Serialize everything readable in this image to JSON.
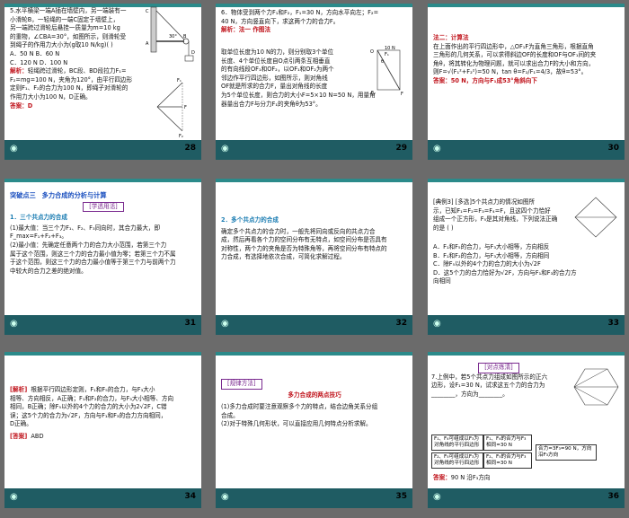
{
  "slides": [
    {
      "num": "28",
      "lines": [
        "5.水平横梁一端A插在墙壁内，另一端装有一",
        "小滑轮B，一轻绳的一端C固定于墙壁上，",
        "另一端跨过滑轮后悬挂一质量为m=10 kg",
        "的重物，∠CBA=30°，如图所示，则滑轮受",
        "到绳子的作用力大小为(g取10 N/kg)(    )",
        "A．50 N                 B．60 N",
        "C．120 N               D．100 N"
      ],
      "analysis_label": "解析：",
      "analysis_lines": [
        "轻绳跨过滑轮，BC段、BD段拉力F₁=",
        "F₂=mg=100 N，夹角为120°，由平行四边形",
        "定则F₁、F₂的合力为100 N，即绳子对滑轮的",
        "作用力大小为100 N，D正确。"
      ],
      "answer": "答案：D",
      "fig_labels": [
        "C",
        "A",
        "B",
        "30°",
        "D",
        "F₁",
        "F",
        "F₂"
      ]
    },
    {
      "num": "29",
      "lines": [
        "6．物体受到两个力F₁和F₂，F₁=30 N，方向水平向左；F₂=",
        "40 N，方向竖直向下，求这两个力的合力F。"
      ],
      "analysis_label": "解析：",
      "method": "法一  作图法",
      "analysis_lines": [
        "取单位长度为10 N的力，则分别取3个单位",
        "长度、4个单位长度自O点引两条互相垂直",
        "的有向线段OF₁和OF₂，以OF₁和OF₂为两个",
        "邻边作平行四边形，如图所示，则对角线",
        "OF就是所求的合力F，量出对角线的长度",
        "为5个单位长度，则合力的大小F=5×10 N=50 N，用量角",
        "器量出合力F与分力F₁的夹角θ为53°。"
      ],
      "fig_labels": [
        "10 N",
        "F₁",
        "O",
        "θ",
        "F₂",
        "F"
      ]
    },
    {
      "num": "30",
      "method": "法二：计算法",
      "lines": [
        "在上面作出的平行四边形中，△OF₁F为直角三角形，根据直角",
        "三角形的几何关系，可以求得斜边OF的长度和OF与OF₁间的夹",
        "角θ，将其转化为物理问题，就可以求出合力F的大小和方向，",
        "则F=√(F₁²+F₂²)=50 N，tan θ=F₂/F₁=4/3，故θ=53°。"
      ],
      "answer_label": "答案：",
      "answer_text": "50 N，方向与F₁成53°角斜向下"
    },
    {
      "num": "31",
      "title_prefix": "突破点三",
      "title": "多力合成的分析与计算",
      "tag": "[学透用活]",
      "sub": "1．三个共点力的合成",
      "lines": [
        "(1)最大值：当三个力F₁、F₂、F₃同向时，其合力最大，即",
        "F_max=F₁+F₂+F₃。",
        "(2)最小值：先确定任意两个力的合力大小范围，若第三个力",
        "属于这个范围，则这三个力的合力最小值为零；若第三个力不属",
        "于这个范围，则这三个力的合力最小值等于第三个力与前两个力",
        "中较大的合力之差的绝对值。"
      ]
    },
    {
      "num": "32",
      "sub": "2．多个共点力的合成",
      "lines": [
        "确定多个共点力的合力时，一般先将同向或反向的共点力合",
        "成，然后再看各个力的空间分布有无特点，如空间分布是否具有",
        "对称性，两个力的夹角是否为特殊角等，再将空间分布有特点的",
        "力合成，有选择地依次合成，可简化求解过程。"
      ]
    },
    {
      "num": "33",
      "lines": [
        "[典例3]  [多选]5个共点力的情况如图所",
        "示，已知F₁=F₂=F₃=F₄=F，且这四个力恰好",
        "组成一个正方形，F₅是其对角线，下列说法正确",
        "的是                    (        )",
        "A．F₁和F₅的合力，与F₃大小相等，方向相反",
        "B．F₁和F₂的合力，与F₃大小相等，方向相同",
        "C．除F₅以外的4个力的合力的大小为√2F",
        "D．这5个力的合力恰好为√2F，方向与F₁和F₃的合力方",
        "向相同"
      ]
    },
    {
      "num": "34",
      "analysis_label": "[解析]",
      "analysis_lines": [
        "根据平行四边形定则，F₁和F₅的合力，与F₃大小",
        "相等、方向相反，A正确；F₁和F₂的合力，与F₃大小相等、方向",
        "相同，B正确；除F₅以外的4个力的合力的大小为2√2F，C错",
        "误；这5个力的合力为√2F，方向与F₁和F₃的合力方向相同，",
        "D正确。"
      ],
      "answer_label": "[答案]",
      "answer_text": "ABD"
    },
    {
      "num": "35",
      "tag": "[规律方法]",
      "title": "多力合成的两点技巧",
      "lines": [
        "(1)多力合成时要注意观察多个力的特点，结合边角关系分组",
        "合成。",
        "(2)对于特殊几何形状，可以直接应用几何特点分析求解。"
      ]
    },
    {
      "num": "36",
      "tag": "[对点练清]",
      "lines": [
        "7.上例中，若5个共点力组成如图所示的正六",
        "边形，设F₁=30 N，试求这五个力的合力为",
        "________，方向为________。"
      ],
      "boxes": [
        "F₁、F₄可组成以F₃为对角线的平行四边形",
        "F₁、F₄的合力与F₃相同=30 N",
        "F₂、F₅可组成以F₃为对角线的平行四边形",
        "F₂、F₅的合力与F₃相同=30 N",
        "合力=3F₃=90 N，方向沿F₃方向"
      ],
      "answer_label": "答案：",
      "answer_text": "90 N   沿F₃方向"
    }
  ]
}
